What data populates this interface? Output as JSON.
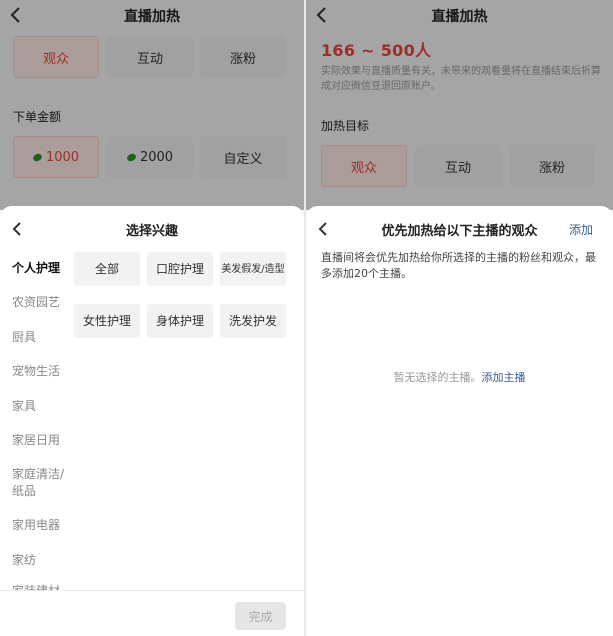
{
  "left": {
    "header": {
      "title": "直播加热"
    },
    "target_options": [
      "观众",
      "互动",
      "涨粉"
    ],
    "amount_label": "下单金额",
    "amount_options": [
      "1000",
      "2000",
      "自定义"
    ],
    "sheet": {
      "title": "选择兴趣",
      "categories": [
        "个人护理",
        "农资园艺",
        "厨具",
        "宠物生活",
        "家具",
        "家居日用",
        "家庭清洁/纸品",
        "家用电器",
        "家纺",
        "家装建材"
      ],
      "chips": [
        "全部",
        "口腔护理",
        "美发假发/造型",
        "女性护理",
        "身体护理",
        "洗发护发"
      ],
      "done_label": "完成"
    }
  },
  "right": {
    "header": {
      "title": "直播加热"
    },
    "range": "166 ~ 500人",
    "note": "实际效果与直播质量有关，未带来的观看量将在直播结束后折算成对应微信豆退回原账户。",
    "target_label": "加热目标",
    "target_options": [
      "观众",
      "互动",
      "涨粉"
    ],
    "sheet": {
      "title": "优先加热给以下主播的观众",
      "add_label": "添加",
      "description": "直播间将会优先加热给你所选择的主播的粉丝和观众，最多添加20个主播。",
      "empty_text": "暂无选择的主播。",
      "empty_link": "添加主播"
    }
  },
  "colors": {
    "accent": "#e8453c",
    "link": "#3a5b9e",
    "coin": "#2a8f2a"
  }
}
